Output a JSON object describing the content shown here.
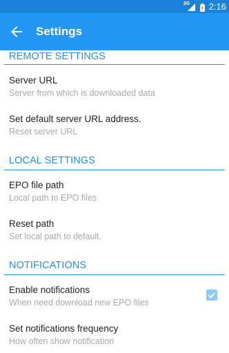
{
  "status_bar": {
    "network_type": "3G",
    "clock": "2:16"
  },
  "app_bar": {
    "title": "Settings"
  },
  "sections": {
    "remote": {
      "title": "REMOTE SETTINGS",
      "items": [
        {
          "title": "Server URL",
          "summary": "Server from which is downloaded data"
        },
        {
          "title": "Set default server URL address.",
          "summary": "Reset server URL"
        }
      ]
    },
    "local": {
      "title": "LOCAL SETTINGS",
      "items": [
        {
          "title": "EPO file path",
          "summary": "Local path to EPO files"
        },
        {
          "title": "Reset path",
          "summary": "Set local path to default."
        }
      ]
    },
    "notifications": {
      "title": "NOTIFICATIONS",
      "items": [
        {
          "title": "Enable notifications",
          "summary": "When need download new EPO files",
          "checked": true
        },
        {
          "title": "Set notifications frequency",
          "summary": "How often show notification"
        }
      ]
    }
  },
  "colors": {
    "status_bar": "#1a82d8",
    "app_bar": "#2196f3",
    "accent": "#1f8fe8",
    "checkbox_checked": "#8ccbf7"
  }
}
